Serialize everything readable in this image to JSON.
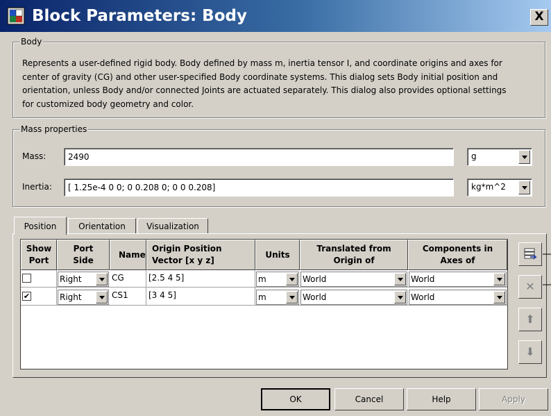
{
  "window": {
    "title": "Block Parameters: Body",
    "icon": "simulink-block-icon",
    "close_label": "X"
  },
  "body_group": {
    "legend": "Body",
    "description": "Represents a user-defined rigid body. Body defined by mass m, inertia tensor I, and coordinate origins and axes for\ncenter of gravity (CG) and other user-specified Body coordinate systems. This dialog sets Body initial position and\norientation, unless Body and/or connected Joints are actuated separately. This dialog also provides optional settings\nfor customized body geometry and color."
  },
  "mass_group": {
    "legend": "Mass properties",
    "mass_label": "Mass:",
    "mass_value": "2490",
    "mass_unit": "g",
    "inertia_label": "Inertia:",
    "inertia_value": "[ 1.25e-4 0 0; 0 0.208 0; 0 0 0.208]",
    "inertia_unit": "kg*m^2"
  },
  "tabs": [
    {
      "label": "Position",
      "active": true
    },
    {
      "label": "Orientation",
      "active": false
    },
    {
      "label": "Visualization",
      "active": false
    }
  ],
  "table": {
    "headers": {
      "show_port": [
        "Show",
        "Port"
      ],
      "port_side": [
        "Port",
        "Side"
      ],
      "name": [
        "Name"
      ],
      "origin": [
        "Origin Position",
        "Vector [x y z]"
      ],
      "units": [
        "Units"
      ],
      "translated": [
        "Translated from",
        "Origin of"
      ],
      "components": [
        "Components in",
        "Axes of"
      ]
    },
    "rows": [
      {
        "show_port": false,
        "port_side": "Right",
        "name": "CG",
        "origin": "[2.5 4 5]",
        "units": "m",
        "translated": "World",
        "components": "World"
      },
      {
        "show_port": true,
        "port_side": "Right",
        "name": "CS1",
        "origin": "[3 4 5]",
        "units": "m",
        "translated": "World",
        "components": "World"
      }
    ],
    "check_mark": "✔"
  },
  "side_buttons": {
    "add_icon": "add-row-icon",
    "delete_label": "✕",
    "up_label": "⬆",
    "down_label": "⬇"
  },
  "buttons": {
    "ok": "OK",
    "cancel": "Cancel",
    "help": "Help",
    "apply": "Apply"
  }
}
